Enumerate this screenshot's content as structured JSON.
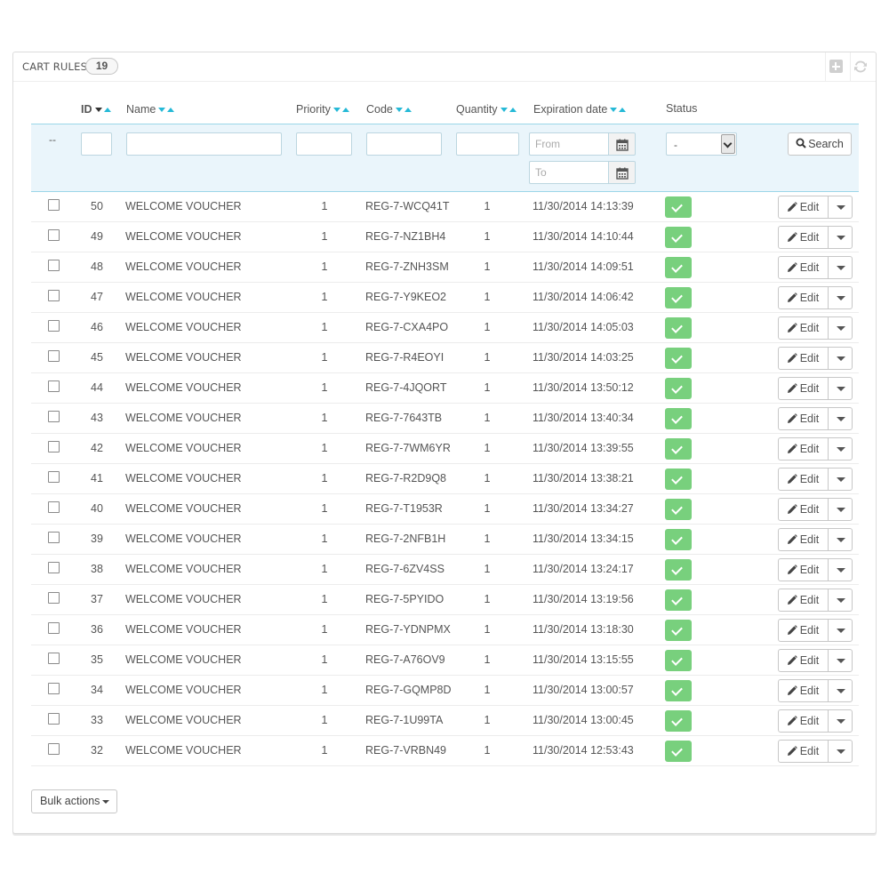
{
  "panel": {
    "title": "CART RULES",
    "count": "19"
  },
  "columns": {
    "id": "ID",
    "name": "Name",
    "priority": "Priority",
    "code": "Code",
    "quantity": "Quantity",
    "expiration": "Expiration date",
    "status": "Status"
  },
  "filters": {
    "id_dash": "--",
    "from_placeholder": "From",
    "to_placeholder": "To",
    "status_value": "-",
    "search_label": "Search"
  },
  "rows": [
    {
      "id": "50",
      "name": "WELCOME VOUCHER",
      "priority": "1",
      "code": "REG-7-WCQ41T",
      "quantity": "1",
      "expiration": "11/30/2014 14:13:39"
    },
    {
      "id": "49",
      "name": "WELCOME VOUCHER",
      "priority": "1",
      "code": "REG-7-NZ1BH4",
      "quantity": "1",
      "expiration": "11/30/2014 14:10:44"
    },
    {
      "id": "48",
      "name": "WELCOME VOUCHER",
      "priority": "1",
      "code": "REG-7-ZNH3SM",
      "quantity": "1",
      "expiration": "11/30/2014 14:09:51"
    },
    {
      "id": "47",
      "name": "WELCOME VOUCHER",
      "priority": "1",
      "code": "REG-7-Y9KEO2",
      "quantity": "1",
      "expiration": "11/30/2014 14:06:42"
    },
    {
      "id": "46",
      "name": "WELCOME VOUCHER",
      "priority": "1",
      "code": "REG-7-CXA4PO",
      "quantity": "1",
      "expiration": "11/30/2014 14:05:03"
    },
    {
      "id": "45",
      "name": "WELCOME VOUCHER",
      "priority": "1",
      "code": "REG-7-R4EOYI",
      "quantity": "1",
      "expiration": "11/30/2014 14:03:25"
    },
    {
      "id": "44",
      "name": "WELCOME VOUCHER",
      "priority": "1",
      "code": "REG-7-4JQORT",
      "quantity": "1",
      "expiration": "11/30/2014 13:50:12"
    },
    {
      "id": "43",
      "name": "WELCOME VOUCHER",
      "priority": "1",
      "code": "REG-7-7643TB",
      "quantity": "1",
      "expiration": "11/30/2014 13:40:34"
    },
    {
      "id": "42",
      "name": "WELCOME VOUCHER",
      "priority": "1",
      "code": "REG-7-7WM6YR",
      "quantity": "1",
      "expiration": "11/30/2014 13:39:55"
    },
    {
      "id": "41",
      "name": "WELCOME VOUCHER",
      "priority": "1",
      "code": "REG-7-R2D9Q8",
      "quantity": "1",
      "expiration": "11/30/2014 13:38:21"
    },
    {
      "id": "40",
      "name": "WELCOME VOUCHER",
      "priority": "1",
      "code": "REG-7-T1953R",
      "quantity": "1",
      "expiration": "11/30/2014 13:34:27"
    },
    {
      "id": "39",
      "name": "WELCOME VOUCHER",
      "priority": "1",
      "code": "REG-7-2NFB1H",
      "quantity": "1",
      "expiration": "11/30/2014 13:34:15"
    },
    {
      "id": "38",
      "name": "WELCOME VOUCHER",
      "priority": "1",
      "code": "REG-7-6ZV4SS",
      "quantity": "1",
      "expiration": "11/30/2014 13:24:17"
    },
    {
      "id": "37",
      "name": "WELCOME VOUCHER",
      "priority": "1",
      "code": "REG-7-5PYIDO",
      "quantity": "1",
      "expiration": "11/30/2014 13:19:56"
    },
    {
      "id": "36",
      "name": "WELCOME VOUCHER",
      "priority": "1",
      "code": "REG-7-YDNPMX",
      "quantity": "1",
      "expiration": "11/30/2014 13:18:30"
    },
    {
      "id": "35",
      "name": "WELCOME VOUCHER",
      "priority": "1",
      "code": "REG-7-A76OV9",
      "quantity": "1",
      "expiration": "11/30/2014 13:15:55"
    },
    {
      "id": "34",
      "name": "WELCOME VOUCHER",
      "priority": "1",
      "code": "REG-7-GQMP8D",
      "quantity": "1",
      "expiration": "11/30/2014 13:00:57"
    },
    {
      "id": "33",
      "name": "WELCOME VOUCHER",
      "priority": "1",
      "code": "REG-7-1U99TA",
      "quantity": "1",
      "expiration": "11/30/2014 13:00:45"
    },
    {
      "id": "32",
      "name": "WELCOME VOUCHER",
      "priority": "1",
      "code": "REG-7-VRBN49",
      "quantity": "1",
      "expiration": "11/30/2014 12:53:43"
    }
  ],
  "row_actions": {
    "edit_label": "Edit"
  },
  "footer": {
    "bulk_label": "Bulk actions"
  },
  "colors": {
    "accent": "#25b9d7",
    "status_enabled": "#78d07d",
    "filter_bg": "#eaf5fb"
  },
  "icons": {
    "add": "add-new-icon",
    "refresh": "refresh-icon",
    "calendar": "calendar-icon",
    "search": "search-icon",
    "pencil": "pencil-icon",
    "status": "check-icon"
  }
}
